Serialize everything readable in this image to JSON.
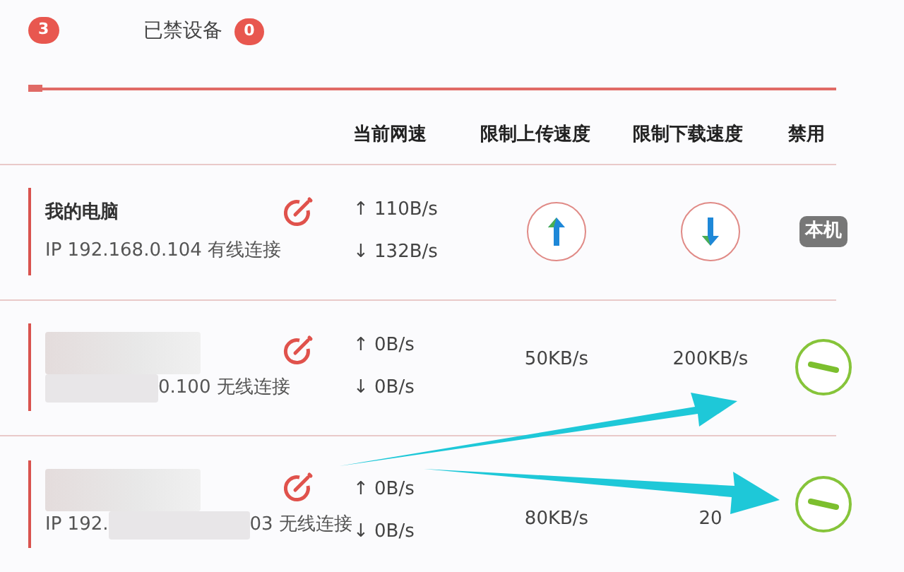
{
  "tabs": [
    {
      "count": "3",
      "selected": true
    },
    {
      "label": "已禁设备",
      "count": "0",
      "selected": false
    }
  ],
  "columns": [
    "当前网速",
    "限制上传速度",
    "限制下载速度",
    "禁用"
  ],
  "devices": [
    {
      "name": "我的电脑",
      "ip_start": "IP 192.168.0.104 有线连接",
      "redacted": false,
      "up": "↑ 110B/s",
      "down": "↓ 132B/s",
      "upload_limit": {
        "kind": "button"
      },
      "download_limit": {
        "kind": "button"
      },
      "disable": {
        "kind": "local",
        "label": "本机"
      }
    },
    {
      "ip_end": "0.100 无线连接",
      "redacted": true,
      "up": "↑ 0B/s",
      "down": "↓ 0B/s",
      "upload_limit": {
        "kind": "text",
        "text": "50KB/s"
      },
      "download_limit": {
        "kind": "text",
        "text": "200KB/s"
      },
      "disable": {
        "kind": "toggle"
      }
    },
    {
      "ip_start": "IP 192.",
      "ip_end": "03 无线连接",
      "redacted": true,
      "up": "↑ 0B/s",
      "down": "↓ 0B/s",
      "upload_limit": {
        "kind": "text",
        "text": "80KB/s"
      },
      "download_limit": {
        "kind": "text",
        "text": "20"
      },
      "disable": {
        "kind": "toggle"
      }
    }
  ]
}
